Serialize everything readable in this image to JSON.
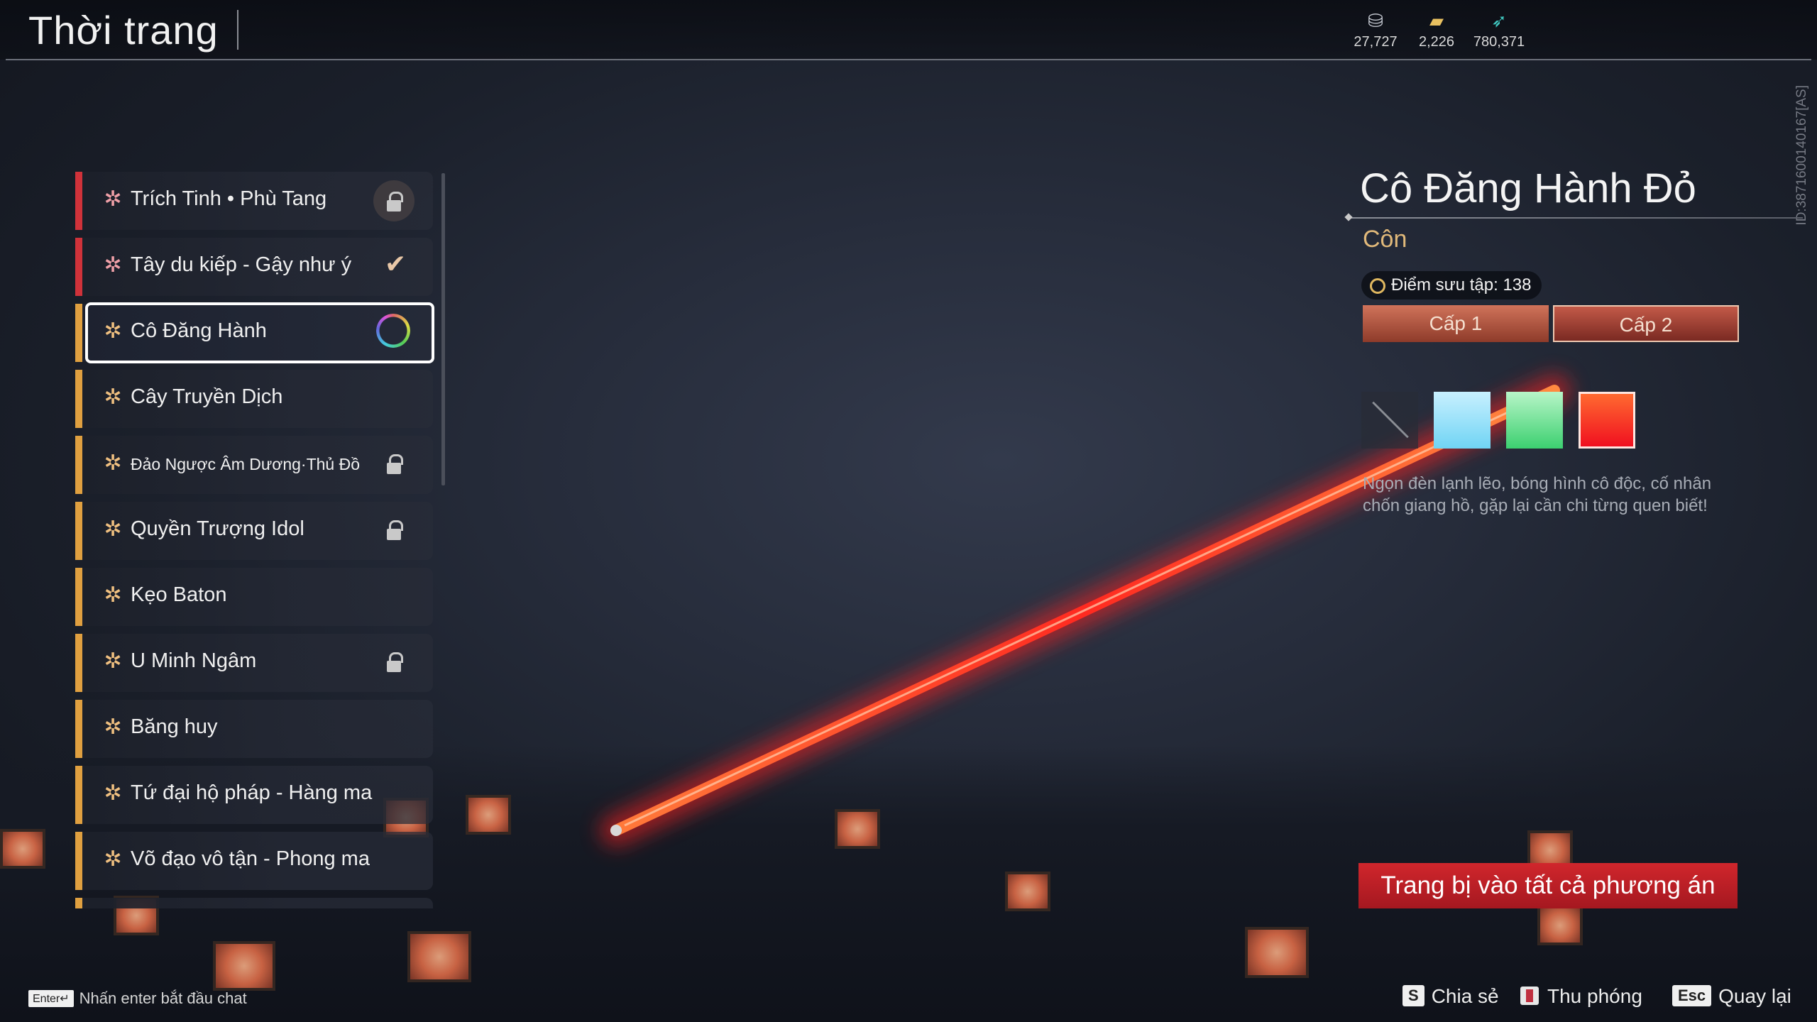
{
  "header": {
    "title": "Thời trang",
    "currencies": [
      {
        "icon": "silver-coin-icon",
        "value": "27,727"
      },
      {
        "icon": "gold-bar-icon",
        "value": "2,226"
      },
      {
        "icon": "feather-icon",
        "value": "780,371"
      }
    ]
  },
  "side_id": "ID:3871600140167[AS]",
  "list": {
    "items": [
      {
        "label": "Trích Tinh • Phù Tang",
        "rarity_color": "#d0323a",
        "status": "locked",
        "icon": "star-icon"
      },
      {
        "label": "Tây du kiếp - Gậy như ý",
        "rarity_color": "#d0323a",
        "status": "equipped",
        "icon": "star-icon"
      },
      {
        "label": "Cô Đăng Hành",
        "rarity_color": "#e0a040",
        "status": "selected",
        "icon": "star-icon"
      },
      {
        "label": "Cây Truyền Dịch",
        "rarity_color": "#e0a040",
        "status": "none",
        "icon": "star-icon"
      },
      {
        "label": "Đảo Ngược Âm Dương·Thủ Đồ",
        "rarity_color": "#e0a040",
        "status": "locked",
        "icon": "star-icon"
      },
      {
        "label": "Quyền Trượng Idol",
        "rarity_color": "#e0a040",
        "status": "locked",
        "icon": "star-icon"
      },
      {
        "label": "Kẹo Baton",
        "rarity_color": "#e0a040",
        "status": "none",
        "icon": "star-icon"
      },
      {
        "label": "U Minh Ngâm",
        "rarity_color": "#e0a040",
        "status": "locked",
        "icon": "star-icon"
      },
      {
        "label": "Băng huy",
        "rarity_color": "#e0a040",
        "status": "none",
        "icon": "star-icon"
      },
      {
        "label": "Tứ đại hộ pháp - Hàng ma",
        "rarity_color": "#e0a040",
        "status": "none",
        "icon": "star-icon"
      },
      {
        "label": "Võ đạo vô tận - Phong ma",
        "rarity_color": "#e0a040",
        "status": "none",
        "icon": "star-icon"
      }
    ]
  },
  "detail": {
    "name": "Cô Đăng Hành Đỏ",
    "type": "Côn",
    "points_label": "Điểm sưu tập: 138",
    "levels": [
      "Cấp 1",
      "Cấp 2"
    ],
    "selected_level": "Cấp 2",
    "color_variants": [
      {
        "name": "default-swatch",
        "color": "#2a2e38"
      },
      {
        "name": "blue-swatch",
        "color": "#8fdcf6"
      },
      {
        "name": "green-swatch",
        "color": "#5ad886"
      },
      {
        "name": "red-swatch",
        "color": "#f42a24"
      }
    ],
    "selected_variant": "red-swatch",
    "description": "Ngọn đèn lạnh lẽo, bóng hình cô độc, cố nhân chốn giang hồ, gặp lại cần chi từng quen biết!",
    "equip_all_label": "Trang bị vào tất cả phương án"
  },
  "footer": {
    "enter_key": "Enter↵",
    "enter_hint": "Nhấn enter bắt đầu chat",
    "actions": [
      {
        "key": "S",
        "label": "Chia sẻ"
      },
      {
        "key": "book-icon",
        "label": "Thu phóng"
      },
      {
        "key": "Esc",
        "label": "Quay lại"
      }
    ]
  },
  "colors": {
    "accent_red": "#c8202a",
    "rarity_orange": "#e0a040",
    "rarity_red": "#d0323a",
    "type_gold": "#e1b97a"
  }
}
